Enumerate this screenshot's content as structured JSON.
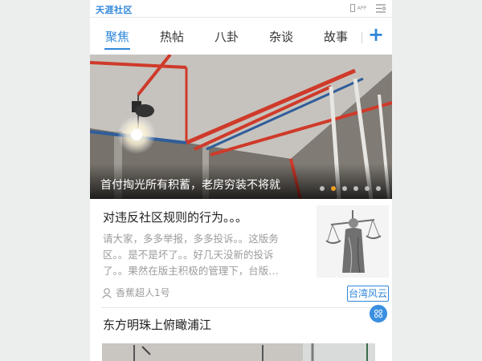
{
  "header": {
    "logo": "天涯社区",
    "app_label": "APP",
    "menu_icon": "menu-list-icon"
  },
  "tabs": [
    {
      "label": "聚焦",
      "active": true
    },
    {
      "label": "热帖",
      "active": false
    },
    {
      "label": "八卦",
      "active": false
    },
    {
      "label": "杂谈",
      "active": false
    },
    {
      "label": "故事",
      "active": false
    }
  ],
  "add_button": "+",
  "banner": {
    "caption": "首付掏光所有积蓄，老房穷装不将就",
    "slides_total": 6,
    "slide_active": 2
  },
  "post": {
    "title": "对违反社区规则的行为。。。",
    "excerpt": "请大家，多多举报，多多投诉。。这版务区。。是不是坏了。。好几天没新的投诉了。。果然在版主积极的管理下，台版…",
    "author": "香蕉超人1号",
    "tag": "台湾风云"
  },
  "post2": {
    "title": "东方明珠上俯瞰浦江"
  },
  "colors": {
    "accent": "#2f86d9",
    "active_dot": "#f0a021"
  }
}
